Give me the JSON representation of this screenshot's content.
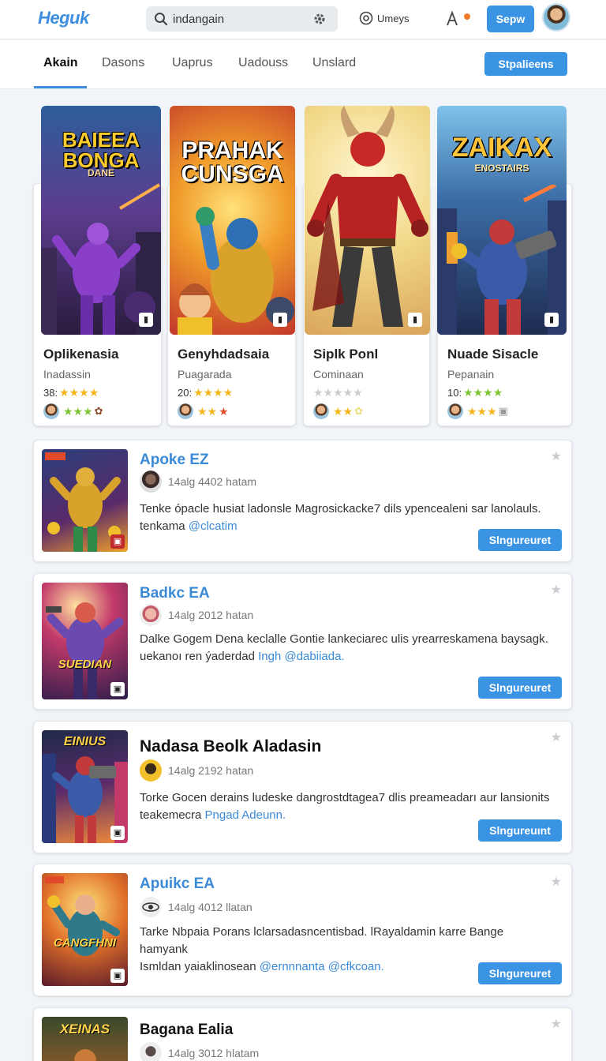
{
  "header": {
    "logo": "Heguk",
    "search_value": "indangain",
    "users_label": "Umeys",
    "signup_label": "Sepw"
  },
  "tabs": {
    "items": [
      {
        "label": "Akain",
        "active": true
      },
      {
        "label": "Dasons",
        "active": false
      },
      {
        "label": "Uaprus",
        "active": false
      },
      {
        "label": "Uadouss",
        "active": false
      },
      {
        "label": "Unslard",
        "active": false
      }
    ],
    "action_label": "Stpalieens"
  },
  "cards": [
    {
      "art_title": "BAIEEA BONGA",
      "art_sub": "DANE",
      "title": "Oplikenasia",
      "subtitle": "Inadassin",
      "rating_count": "38:",
      "stars": 4,
      "star_color": "#f3b51a"
    },
    {
      "art_title": "PRAHAK CUNSGA",
      "art_sub": "",
      "title": "Genyhdadsaia",
      "subtitle": "Puagarada",
      "rating_count": "20:",
      "stars": 4,
      "star_color": "#f3b51a"
    },
    {
      "art_title": "",
      "art_sub": "",
      "title": "Siplk Ponl",
      "subtitle": "Cominaan",
      "rating_count": "",
      "stars": 0,
      "star_color": "#cccccc"
    },
    {
      "art_title": "ZAIKAX",
      "art_sub": "ENOSTAIRS",
      "title": "Nuade Sisacle",
      "subtitle": "Pepanain",
      "rating_count": "10:",
      "stars": 4,
      "star_color": "#7ec535"
    }
  ],
  "posts": [
    {
      "thumb_title": "",
      "title": "Apoke EZ",
      "title_style": "blue",
      "meta": "14alg 4402 hatam",
      "body": "Tenke ópacle husiat ladonsle Magrosickacke7 dils ypencealeni sar lanolauls.",
      "body2": "tenkama",
      "tag": "@clcatim",
      "button": "Slngureuret"
    },
    {
      "thumb_title": "SUEDIAN",
      "title": "Badkc EA",
      "title_style": "blue",
      "meta": "14alg 2012 hatan",
      "body": "Dalke Gogem Dena keclalle Gontie lankeciarec ulis yrearreskamena baysagk.",
      "body2": "uekanoı ren ýaderdad",
      "tag": "Ingh @dabiiada.",
      "button": "Slngureuret"
    },
    {
      "thumb_title": "EINIUS",
      "title": "Nadasa Beolk Aladasin",
      "title_style": "dark",
      "meta": "14alg 2192 hatan",
      "body": "Torke Gocen derains ludeske dangrostdtagea7 dlis preameadarı aur lansionits",
      "body2": "teakemecra",
      "tag": "Pngad Adeunn.",
      "button": "Slngureuınt"
    },
    {
      "thumb_title": "CANGFHNI",
      "title": "Apuikc EA",
      "title_style": "blue",
      "meta": "14alg 4012 llatan",
      "body": "Tarke Nbpaia Porans lclarsadasncentisbad. lRayaldamin karre Bange hamyank",
      "body2": "Ismldan yaiaklinosean",
      "tag": "@ernnnanta @cfkcoan.",
      "button": "Slngureuret"
    },
    {
      "thumb_title": "XEINAS",
      "title": "Bagana Ealia",
      "title_style": "dark",
      "meta": "14alg 3012 hlatam",
      "body": "",
      "body2": "",
      "tag": "",
      "button": ""
    }
  ]
}
